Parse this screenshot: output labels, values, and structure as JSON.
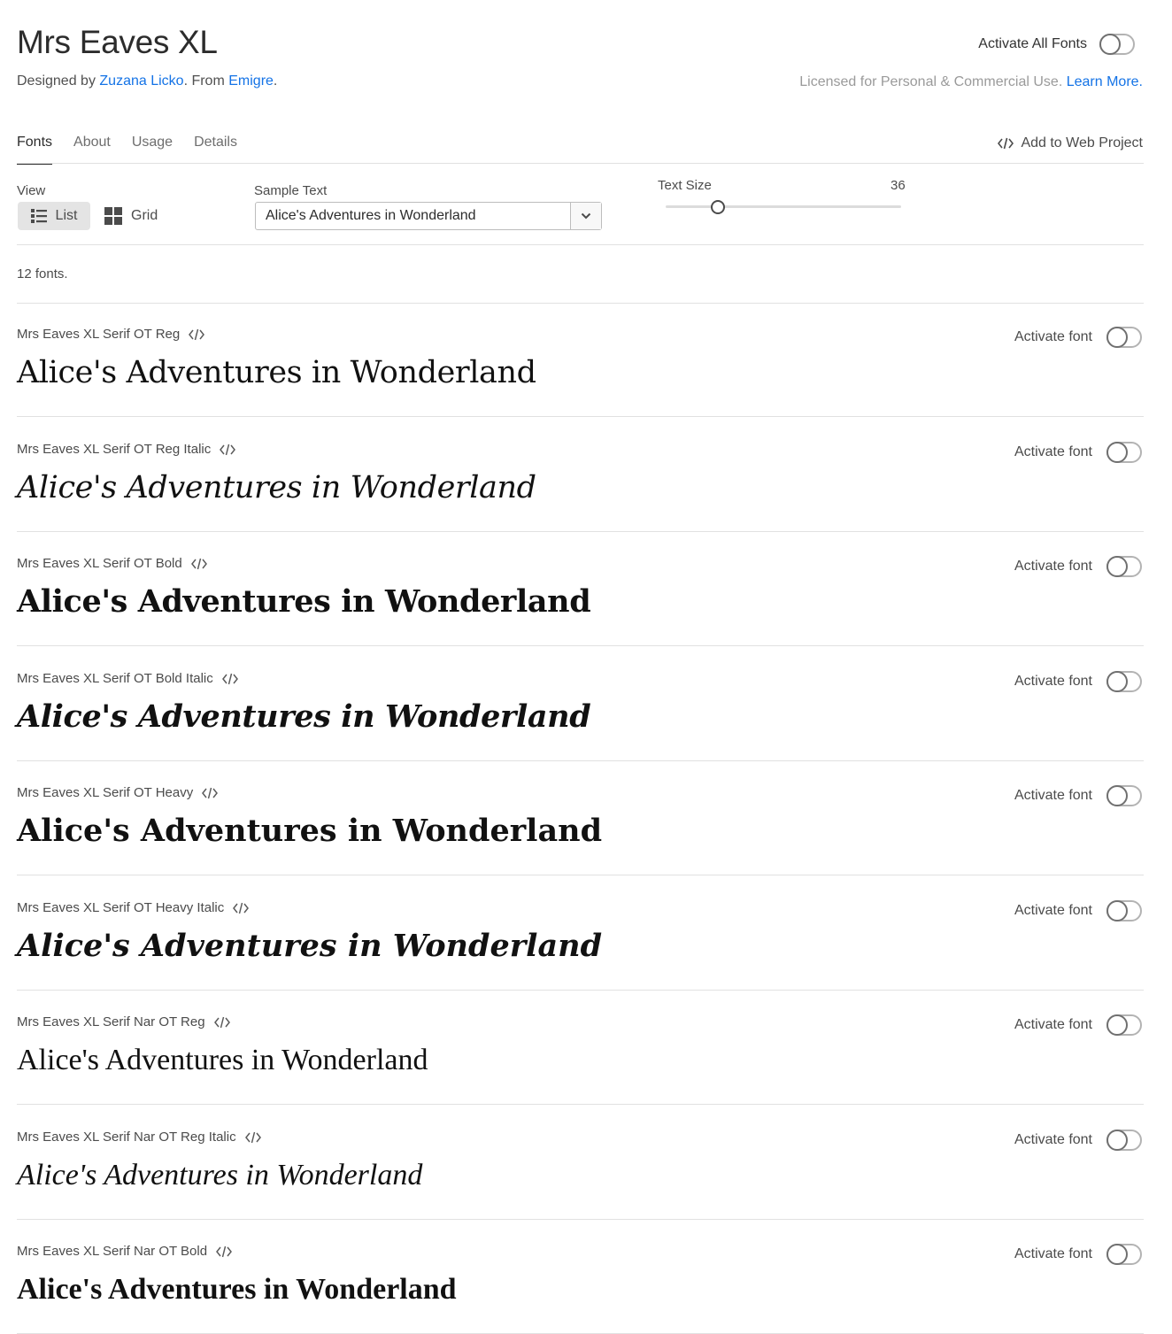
{
  "header": {
    "title": "Mrs Eaves XL",
    "designed_by_prefix": "Designed by ",
    "designer": "Zuzana Licko",
    "from_prefix": ". From ",
    "foundry": "Emigre",
    "from_suffix": ".",
    "activate_all_label": "Activate All Fonts",
    "activate_all_on": false,
    "license_text": "Licensed for Personal & Commercial Use.",
    "learn_more": "Learn More."
  },
  "tabs": [
    {
      "label": "Fonts",
      "active": true
    },
    {
      "label": "About",
      "active": false
    },
    {
      "label": "Usage",
      "active": false
    },
    {
      "label": "Details",
      "active": false
    }
  ],
  "add_to_web_project": "Add to Web Project",
  "controls": {
    "view_label": "View",
    "view_list": "List",
    "view_grid": "Grid",
    "view_selected": "List",
    "sample_label": "Sample Text",
    "sample_value": "Alice's Adventures in Wonderland",
    "text_size_label": "Text Size",
    "text_size_value": "36",
    "text_size_fraction": 0.22
  },
  "font_count": "12 fonts.",
  "fonts": [
    {
      "name": "Mrs Eaves XL Serif OT Reg",
      "style": "reg",
      "sample": "Alice's Adventures in Wonderland",
      "activate_label": "Activate font",
      "active": false
    },
    {
      "name": "Mrs Eaves XL Serif OT Reg Italic",
      "style": "italic",
      "sample": "Alice's Adventures in Wonderland",
      "activate_label": "Activate font",
      "active": false
    },
    {
      "name": "Mrs Eaves XL Serif OT Bold",
      "style": "bold",
      "sample": "Alice's Adventures in Wonderland",
      "activate_label": "Activate font",
      "active": false
    },
    {
      "name": "Mrs Eaves XL Serif OT Bold Italic",
      "style": "bolditalic",
      "sample": "Alice's Adventures in Wonderland",
      "activate_label": "Activate font",
      "active": false
    },
    {
      "name": "Mrs Eaves XL Serif OT Heavy",
      "style": "heavy",
      "sample": "Alice's Adventures in Wonderland",
      "activate_label": "Activate font",
      "active": false
    },
    {
      "name": "Mrs Eaves XL Serif OT Heavy Italic",
      "style": "heavyitalic",
      "sample": "Alice's Adventures in Wonderland",
      "activate_label": "Activate font",
      "active": false
    },
    {
      "name": "Mrs Eaves XL Serif Nar OT Reg",
      "style": "reg nar",
      "sample": "Alice's Adventures in Wonderland",
      "activate_label": "Activate font",
      "active": false
    },
    {
      "name": "Mrs Eaves XL Serif Nar OT Reg Italic",
      "style": "italic nar",
      "sample": "Alice's Adventures in Wonderland",
      "activate_label": "Activate font",
      "active": false
    },
    {
      "name": "Mrs Eaves XL Serif Nar OT Bold",
      "style": "bold nar",
      "sample": "Alice's Adventures in Wonderland",
      "activate_label": "Activate font",
      "active": false
    }
  ],
  "colors": {
    "link": "#1473e6",
    "text": "#2c2c2c",
    "muted": "#9a9a9a",
    "divider": "#e1e1e1"
  },
  "icons": {
    "code": "code-brackets-icon",
    "list": "list-icon",
    "grid": "grid-icon",
    "dropdown": "chevron-down-icon"
  }
}
